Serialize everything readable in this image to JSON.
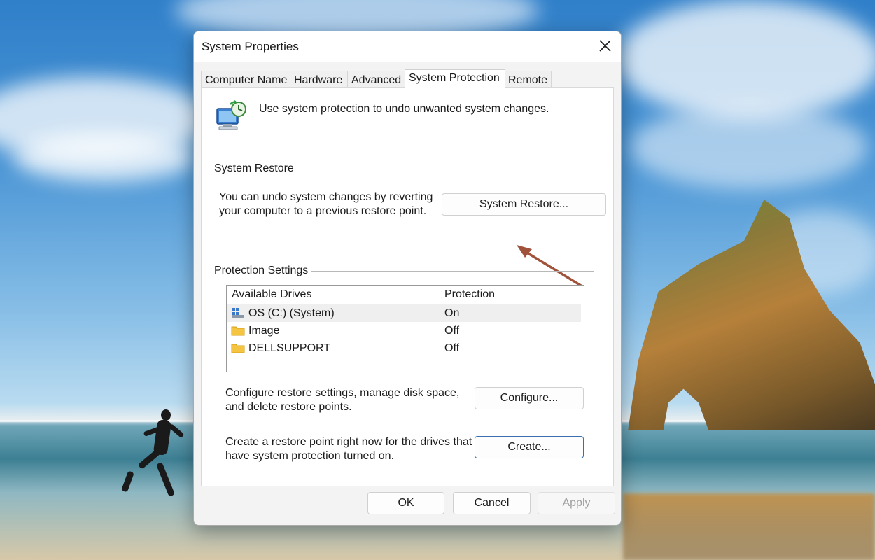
{
  "window": {
    "title": "System Properties",
    "close_icon": "close-icon"
  },
  "tabs": [
    {
      "label": "Computer Name",
      "active": false
    },
    {
      "label": "Hardware",
      "active": false
    },
    {
      "label": "Advanced",
      "active": false
    },
    {
      "label": "System Protection",
      "active": true
    },
    {
      "label": "Remote",
      "active": false
    }
  ],
  "intro": {
    "icon": "system-protection-icon",
    "text": "Use system protection to undo unwanted system changes."
  },
  "system_restore": {
    "group_label": "System Restore",
    "description_line1": "You can undo system changes by reverting",
    "description_line2": "your computer to a previous restore point.",
    "button_label": "System Restore..."
  },
  "protection_settings": {
    "group_label": "Protection Settings",
    "columns": [
      "Available Drives",
      "Protection"
    ],
    "drives": [
      {
        "name": "OS (C:) (System)",
        "protection": "On",
        "icon": "system-drive-icon",
        "selected": true
      },
      {
        "name": "Image",
        "protection": "Off",
        "icon": "folder-drive-icon",
        "selected": false
      },
      {
        "name": "DELLSUPPORT",
        "protection": "Off",
        "icon": "folder-drive-icon",
        "selected": false
      }
    ],
    "configure": {
      "description_line1": "Configure restore settings, manage disk space,",
      "description_line2": "and delete restore points.",
      "button_label": "Configure..."
    },
    "create": {
      "description_line1": "Create a restore point right now for the drives that",
      "description_line2": "have system protection turned on.",
      "button_label": "Create..."
    }
  },
  "footer": {
    "ok_label": "OK",
    "cancel_label": "Cancel",
    "apply_label": "Apply"
  },
  "colors": {
    "annotation_arrow": "#a0523a",
    "primary_border": "#3a6fb0"
  }
}
